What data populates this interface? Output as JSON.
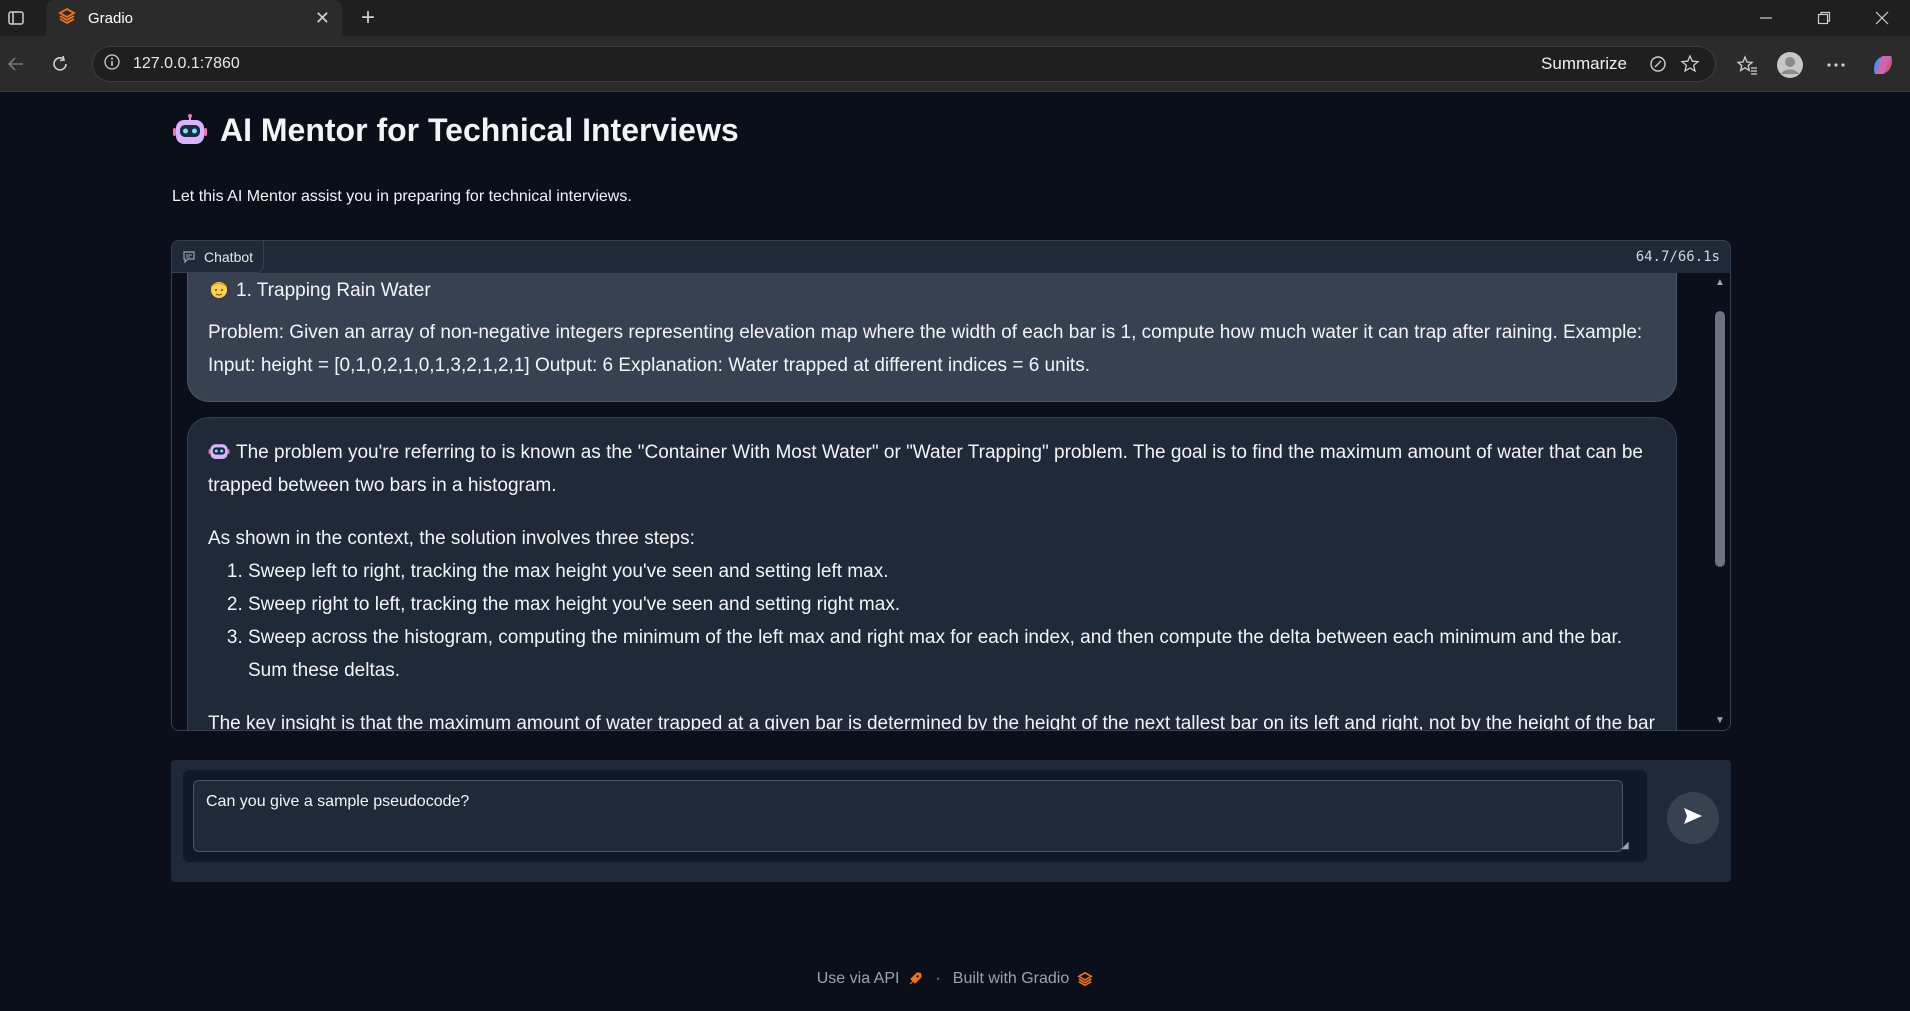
{
  "browser": {
    "tab_title": "Gradio",
    "url": "127.0.0.1:7860",
    "summarize_label": "Summarize"
  },
  "page": {
    "title": "AI Mentor for Technical Interviews",
    "description": "Let this AI Mentor assist you in preparing for technical interviews."
  },
  "chatbot": {
    "label": "Chatbot",
    "timer": "64.7/66.1s",
    "user_message": {
      "heading": "1. Trapping Rain Water",
      "body": "Problem: Given an array of non-negative integers representing elevation map where the width of each bar is 1, compute how much water it can trap after raining. Example: Input: height = [0,1,0,2,1,0,1,3,2,1,2,1] Output: 6 Explanation: Water trapped at different indices = 6 units."
    },
    "bot_message": {
      "intro": "The problem you're referring to is known as the \"Container With Most Water\" or \"Water Trapping\" problem. The goal is to find the maximum amount of water that can be trapped between two bars in a histogram.",
      "steps_intro": "As shown in the context, the solution involves three steps:",
      "steps": [
        "Sweep left to right, tracking the max height you've seen and setting left max.",
        "Sweep right to left, tracking the max height you've seen and setting right max.",
        "Sweep across the histogram, computing the minimum of the left max and right max for each index, and then compute the delta between each minimum and the bar. Sum these deltas."
      ],
      "insight": "The key insight is that the maximum amount of water trapped at a given bar is determined by the height of the next tallest bar on its left and right, not by the height of the bar"
    }
  },
  "input": {
    "value": "Can you give a sample pseudocode?"
  },
  "footer": {
    "api_label": "Use via API",
    "separator": "·",
    "built_label": "Built with Gradio"
  },
  "colors": {
    "background": "#0b0f19",
    "panel": "#1f2937",
    "user_bubble": "#374151",
    "gradio_orange": "#f97316"
  }
}
